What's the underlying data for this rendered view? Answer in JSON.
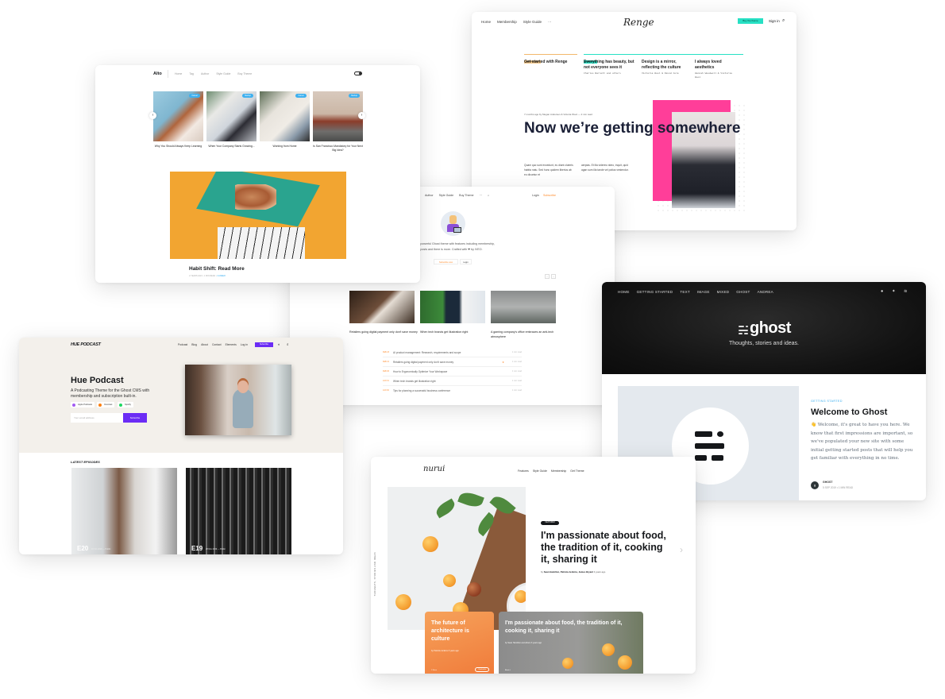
{
  "renge": {
    "nav": [
      "Home",
      "Membership",
      "Style Guide",
      "···"
    ],
    "logo": "Renge",
    "cta": "Buy the theme",
    "signin": "Sign in",
    "search_icon": "⌕",
    "section_labels": [
      "Featured posts",
      "Most recent"
    ],
    "featured": [
      {
        "title": "Get started with Renge",
        "authors": ""
      },
      {
        "title": "Everything has beauty, but not everyone sees it",
        "authors": "Charles Barnett and others"
      },
      {
        "title": "Design is a mirror, reflecting the culture",
        "authors": "Victoria Wool & David Cole"
      },
      {
        "title": "I always loved aesthetics",
        "authors": "Hannah Woodwell & Victoria Wool"
      }
    ],
    "post_meta": "7 months ago by Megan Andersen & Victoria Wool — 2 min read",
    "headline": "Now we’re getting somewhere",
    "excerpt_col1": "Quam quo sunt excedunt, eu diant cluteris habita natu. Sed hunc quidem liberius ab eo dicuntur et",
    "excerpt_col2": "aerpias. Et illa videres video, inquit, quid agan sum illa tande vel potius vestendur."
  },
  "alto": {
    "brand": "Alto",
    "nav": [
      "Home",
      "Tag",
      "Author",
      "Style Guide",
      "Buy Theme"
    ],
    "carousel": [
      {
        "tag": "Career",
        "caption": "Why You Should Always Keep Learning"
      },
      {
        "tag": "Startup",
        "caption": "When Your Company Starts Growing..."
      },
      {
        "tag": "Career",
        "caption": "Working from Home"
      },
      {
        "tag": "Startup",
        "caption": "Is San Francisco Mandatory for Your Next Big Idea?"
      }
    ],
    "prev_icon": "‹",
    "next_icon": "›",
    "featured_title": "Habit Shift: Read More",
    "featured_meta": "2 YEARS AGO • 1 MIN READ •",
    "featured_tag": "CAREER"
  },
  "dawn": {
    "nav": [
      "Author",
      "Style Guide",
      "Buy Theme",
      "···",
      "⌕"
    ],
    "login": "Login",
    "subscribe": "Subscribe",
    "intro": "Hey! Dawn is a simple yet powerful Ghost theme with features including membership, search, featured posts and there is more. Crafted with ❤ by IVEO.",
    "subscribe_btn": "Subscribe now",
    "login_btn": "Login",
    "prev": "‹",
    "next": "›",
    "featured": [
      "Retailers going digital payment only don't save money",
      "When tech brands get illustration right",
      "A gaming company's office embraces an anti-tech atmosphere"
    ],
    "list": [
      {
        "date": "FEB 23",
        "title": "AI product management: Research, requirements and scope",
        "read": "1 min read",
        "featured": false
      },
      {
        "date": "FEB 21",
        "title": "Retailers going digital payment only don't save money",
        "read": "1 min read",
        "featured": true
      },
      {
        "date": "FEB 06",
        "title": "How to Ergonomically Optimize Your Workspace",
        "read": "1 min read",
        "featured": false
      },
      {
        "date": "JAN 31",
        "title": "When tech brands get illustration right",
        "read": "1 min read",
        "featured": false
      },
      {
        "date": "JAN 30",
        "title": "Tips for planning a successful business conference",
        "read": "1 min read",
        "featured": false
      }
    ]
  },
  "hue": {
    "brand": "HUE PODCAST",
    "nav": [
      "Podcast",
      "Blog",
      "About",
      "Contact",
      "Elements",
      "Log in"
    ],
    "subscribe": "Subscribe",
    "title": "Hue Podcast",
    "subtitle": "A Podcasting Theme for the Ghost CMS with membership and subscription built-in.",
    "platforms": [
      {
        "name": "Apple Podcasts",
        "color": "#a35bf2"
      },
      {
        "name": "Overcast",
        "color": "#fc7e0f"
      },
      {
        "name": "Spotify",
        "color": "#1ed760"
      }
    ],
    "email_placeholder": "Your email address",
    "email_button": "Subscribe",
    "latest": "LATEST EPISODES",
    "episodes": [
      {
        "number": "E20",
        "meta": "16 Oct 2019 — Public"
      },
      {
        "number": "E19",
        "meta": "28 Nov 2019 — Public"
      }
    ]
  },
  "ghost": {
    "nav": [
      "HOME",
      "GETTING STARTED",
      "TEXT",
      "IMAGE",
      "MIXED",
      "GHOST",
      "ANDREA"
    ],
    "social": [
      "f",
      "t",
      "rss"
    ],
    "logo": "ghost",
    "tagline": "Thoughts, stories and ideas.",
    "category": "GETTING STARTED",
    "title": "Welcome to Ghost",
    "excerpt": "👋 Welcome, it's great to have you here. We know that first impressions are important, so we've populated your new site with some initial getting started posts that will help you get familiar with everything in no time.",
    "author": "GHOST",
    "meta": "5 SEP 2019 • 1 MIN READ"
  },
  "nurui": {
    "logo": "nurui",
    "nav": [
      "Features",
      "Style Guide",
      "Membership",
      "Get Theme"
    ],
    "side_text": "THOUGHTS, STORIES AND IDEAS",
    "tag": "FEATURED",
    "headline": "I'm passionate about food, the tradition of it, cooking it, sharing it",
    "byline_prefix": "by",
    "byline_authors": "Sean Hamilton, Patricia Jenkins, James Bryant",
    "byline_time": "3 years ago",
    "chevron": "›",
    "cards": [
      {
        "title": "The future of architecture is culture",
        "by": "by Patricia Jenkins 3 years ago",
        "foot": "1 Share",
        "btn": "Read article"
      },
      {
        "title": "I'm passionate about food, the tradition of it, cooking it, sharing it",
        "by": "by Sean Hamilton and others 3 years ago",
        "foot": "About it"
      }
    ]
  }
}
